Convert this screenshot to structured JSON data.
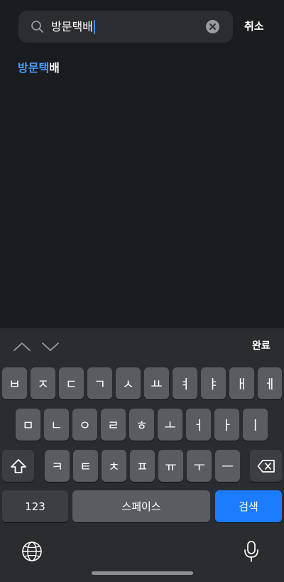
{
  "search": {
    "query": "방문택배",
    "cancel_label": "취소"
  },
  "suggestions": [
    {
      "highlight": "방문택",
      "rest": "배"
    }
  ],
  "keyboard": {
    "done_label": "완료",
    "row1": [
      "ㅂ",
      "ㅈ",
      "ㄷ",
      "ㄱ",
      "ㅅ",
      "ㅛ",
      "ㅕ",
      "ㅑ",
      "ㅐ",
      "ㅔ"
    ],
    "row2": [
      "ㅁ",
      "ㄴ",
      "ㅇ",
      "ㄹ",
      "ㅎ",
      "ㅗ",
      "ㅓ",
      "ㅏ",
      "ㅣ"
    ],
    "row3": [
      "ㅋ",
      "ㅌ",
      "ㅊ",
      "ㅍ",
      "ㅠ",
      "ㅜ",
      "ㅡ"
    ],
    "numbers_label": "123",
    "space_label": "스페이스",
    "search_label": "검색",
    "icons": {
      "shift": "shift-icon",
      "delete": "backspace-icon",
      "globe": "globe-icon",
      "mic": "microphone-icon",
      "up": "chevron-up-icon",
      "down": "chevron-down-icon"
    }
  },
  "colors": {
    "background": "#1b1c20",
    "search_field": "#2c2d31",
    "highlight": "#4a9cff",
    "key": "#5b5c61",
    "key_dark": "#3d3e43",
    "search_key": "#1c7cff"
  }
}
